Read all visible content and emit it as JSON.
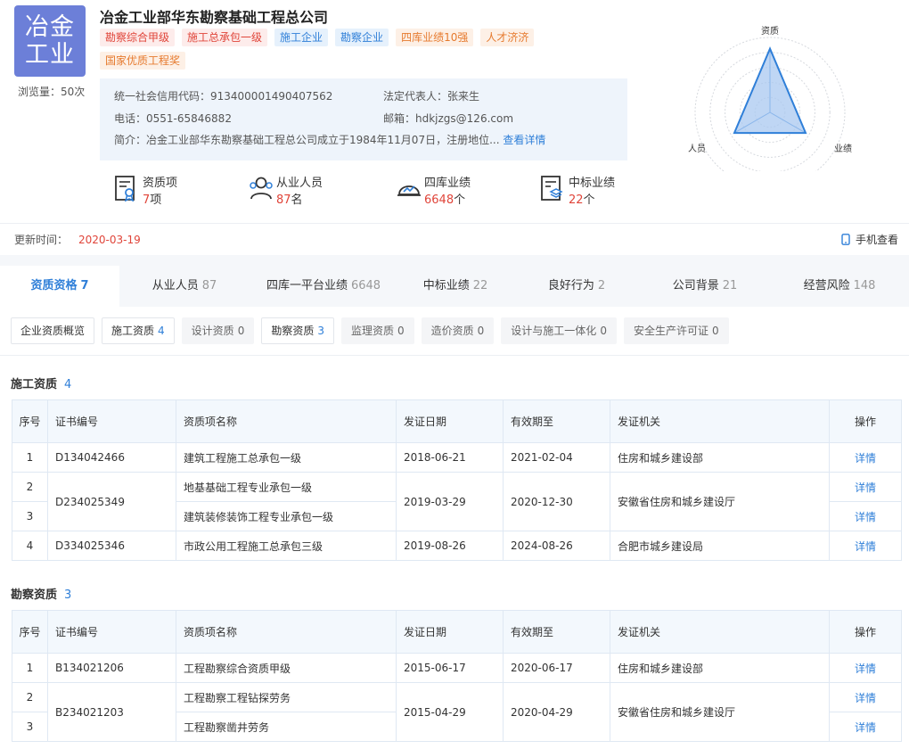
{
  "header": {
    "logo_line1": "冶金",
    "logo_line2": "工业",
    "views": "浏览量：50次",
    "company_name": "冶金工业部华东勘察基础工程总公司",
    "tags": [
      {
        "label": "勘察综合甲级",
        "color": "red"
      },
      {
        "label": "施工总承包一级",
        "color": "red"
      },
      {
        "label": "施工企业",
        "color": "blue"
      },
      {
        "label": "勘察企业",
        "color": "blue"
      },
      {
        "label": "四库业绩10强",
        "color": "orange"
      },
      {
        "label": "人才济济",
        "color": "orange"
      },
      {
        "label": "国家优质工程奖",
        "color": "orange"
      }
    ],
    "info": {
      "credit_code": "统一社会信用代码：913400001490407562",
      "legal_rep": "法定代表人：张来生",
      "phone": "电话：0551-65846882",
      "email": "邮箱：hdkjzgs@126.com",
      "intro": "简介：冶金工业部华东勘察基础工程总公司成立于1984年11月07日，注册地位...",
      "detail_link": "查看详情"
    },
    "stats": [
      {
        "icon": "certificate-icon",
        "label": "资质项",
        "value": "7",
        "unit": "项"
      },
      {
        "icon": "people-icon",
        "label": "从业人员",
        "value": "87",
        "unit": "名"
      },
      {
        "icon": "helmet-icon",
        "label": "四库业绩",
        "value": "6648",
        "unit": "个"
      },
      {
        "icon": "document-stack-icon",
        "label": "中标业绩",
        "value": "22",
        "unit": "个"
      }
    ],
    "radar": {
      "labels": {
        "top": "资质",
        "left": "人员",
        "right": "业绩"
      },
      "levels": {
        "qualification": 0.85,
        "personnel": 0.55,
        "performance": 0.55
      },
      "colors": {
        "fill": "#a9c8f0",
        "stroke": "#2f7fd8"
      }
    }
  },
  "update": {
    "label": "更新时间：",
    "date": "2020-03-19",
    "mobile_label": "手机查看"
  },
  "main_tabs": [
    {
      "label": "资质资格",
      "count": "7",
      "active": true
    },
    {
      "label": "从业人员",
      "count": "87"
    },
    {
      "label": "四库一平台业绩",
      "count": "6648"
    },
    {
      "label": "中标业绩",
      "count": "22"
    },
    {
      "label": "良好行为",
      "count": "2"
    },
    {
      "label": "公司背景",
      "count": "21"
    },
    {
      "label": "经营风险",
      "count": "148"
    }
  ],
  "sub_tabs": [
    {
      "label": "企业资质概览",
      "count": ""
    },
    {
      "label": "施工资质",
      "count": "4"
    },
    {
      "label": "设计资质",
      "count": "0",
      "disabled": true
    },
    {
      "label": "勘察资质",
      "count": "3"
    },
    {
      "label": "监理资质",
      "count": "0",
      "disabled": true
    },
    {
      "label": "造价资质",
      "count": "0",
      "disabled": true
    },
    {
      "label": "设计与施工一体化",
      "count": "0",
      "disabled": true
    },
    {
      "label": "安全生产许可证",
      "count": "0",
      "disabled": true
    }
  ],
  "columns": [
    "序号",
    "证书编号",
    "资质项名称",
    "发证日期",
    "有效期至",
    "发证机关",
    "操作"
  ],
  "construction": {
    "title": "施工资质",
    "count": "4",
    "rows": [
      {
        "idx": "1",
        "cert": "D134042466",
        "name": "建筑工程施工总承包一级",
        "issued": "2018-06-21",
        "expires": "2021-02-04",
        "authority": "住房和城乡建设部",
        "op": "详情"
      },
      {
        "idx": "2",
        "cert": "D234025349",
        "name": "地基基础工程专业承包一级",
        "issued": "2019-03-29",
        "expires": "2020-12-30",
        "authority": "安徽省住房和城乡建设厅",
        "op": "详情"
      },
      {
        "idx": "3",
        "name": "建筑装修装饰工程专业承包一级",
        "op": "详情"
      },
      {
        "idx": "4",
        "cert": "D334025346",
        "name": "市政公用工程施工总承包三级",
        "issued": "2019-08-26",
        "expires": "2024-08-26",
        "authority": "合肥市城乡建设局",
        "op": "详情"
      }
    ]
  },
  "survey": {
    "title": "勘察资质",
    "count": "3",
    "rows": [
      {
        "idx": "1",
        "cert": "B134021206",
        "name": "工程勘察综合资质甲级",
        "issued": "2015-06-17",
        "expires": "2020-06-17",
        "authority": "住房和城乡建设部",
        "op": "详情"
      },
      {
        "idx": "2",
        "cert": "B234021203",
        "name": "工程勘察工程钻探劳务",
        "issued": "2015-04-29",
        "expires": "2020-04-29",
        "authority": "安徽省住房和城乡建设厅",
        "op": "详情"
      },
      {
        "idx": "3",
        "name": "工程勘察凿井劳务",
        "op": "详情"
      }
    ]
  }
}
